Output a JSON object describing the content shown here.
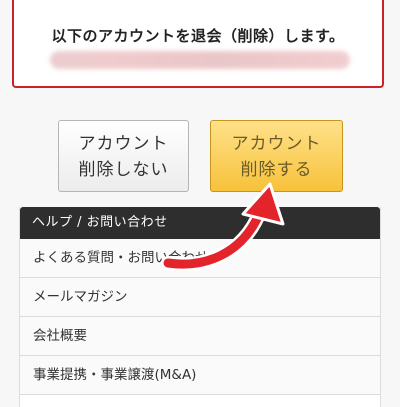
{
  "notice": {
    "message": "以下のアカウントを退会（削除）します。"
  },
  "buttons": {
    "keep_line1": "アカウント",
    "keep_line2": "削除しない",
    "delete_line1": "アカウント",
    "delete_line2": "削除する"
  },
  "menu": {
    "header": "ヘルプ / お問い合わせ",
    "items": [
      {
        "label": "よくある質問・お問い合わせ"
      },
      {
        "label": "メールマガジン"
      },
      {
        "label": "会社概要"
      },
      {
        "label": "事業提携・事業譲渡(M&A)"
      }
    ]
  },
  "colors": {
    "notice_border": "#cc2227",
    "delete_button": "#f7c23a",
    "menu_header": "#2e2e2e",
    "arrow": "#e3242b"
  },
  "icons": {
    "arrow": "curved-arrow-icon"
  }
}
